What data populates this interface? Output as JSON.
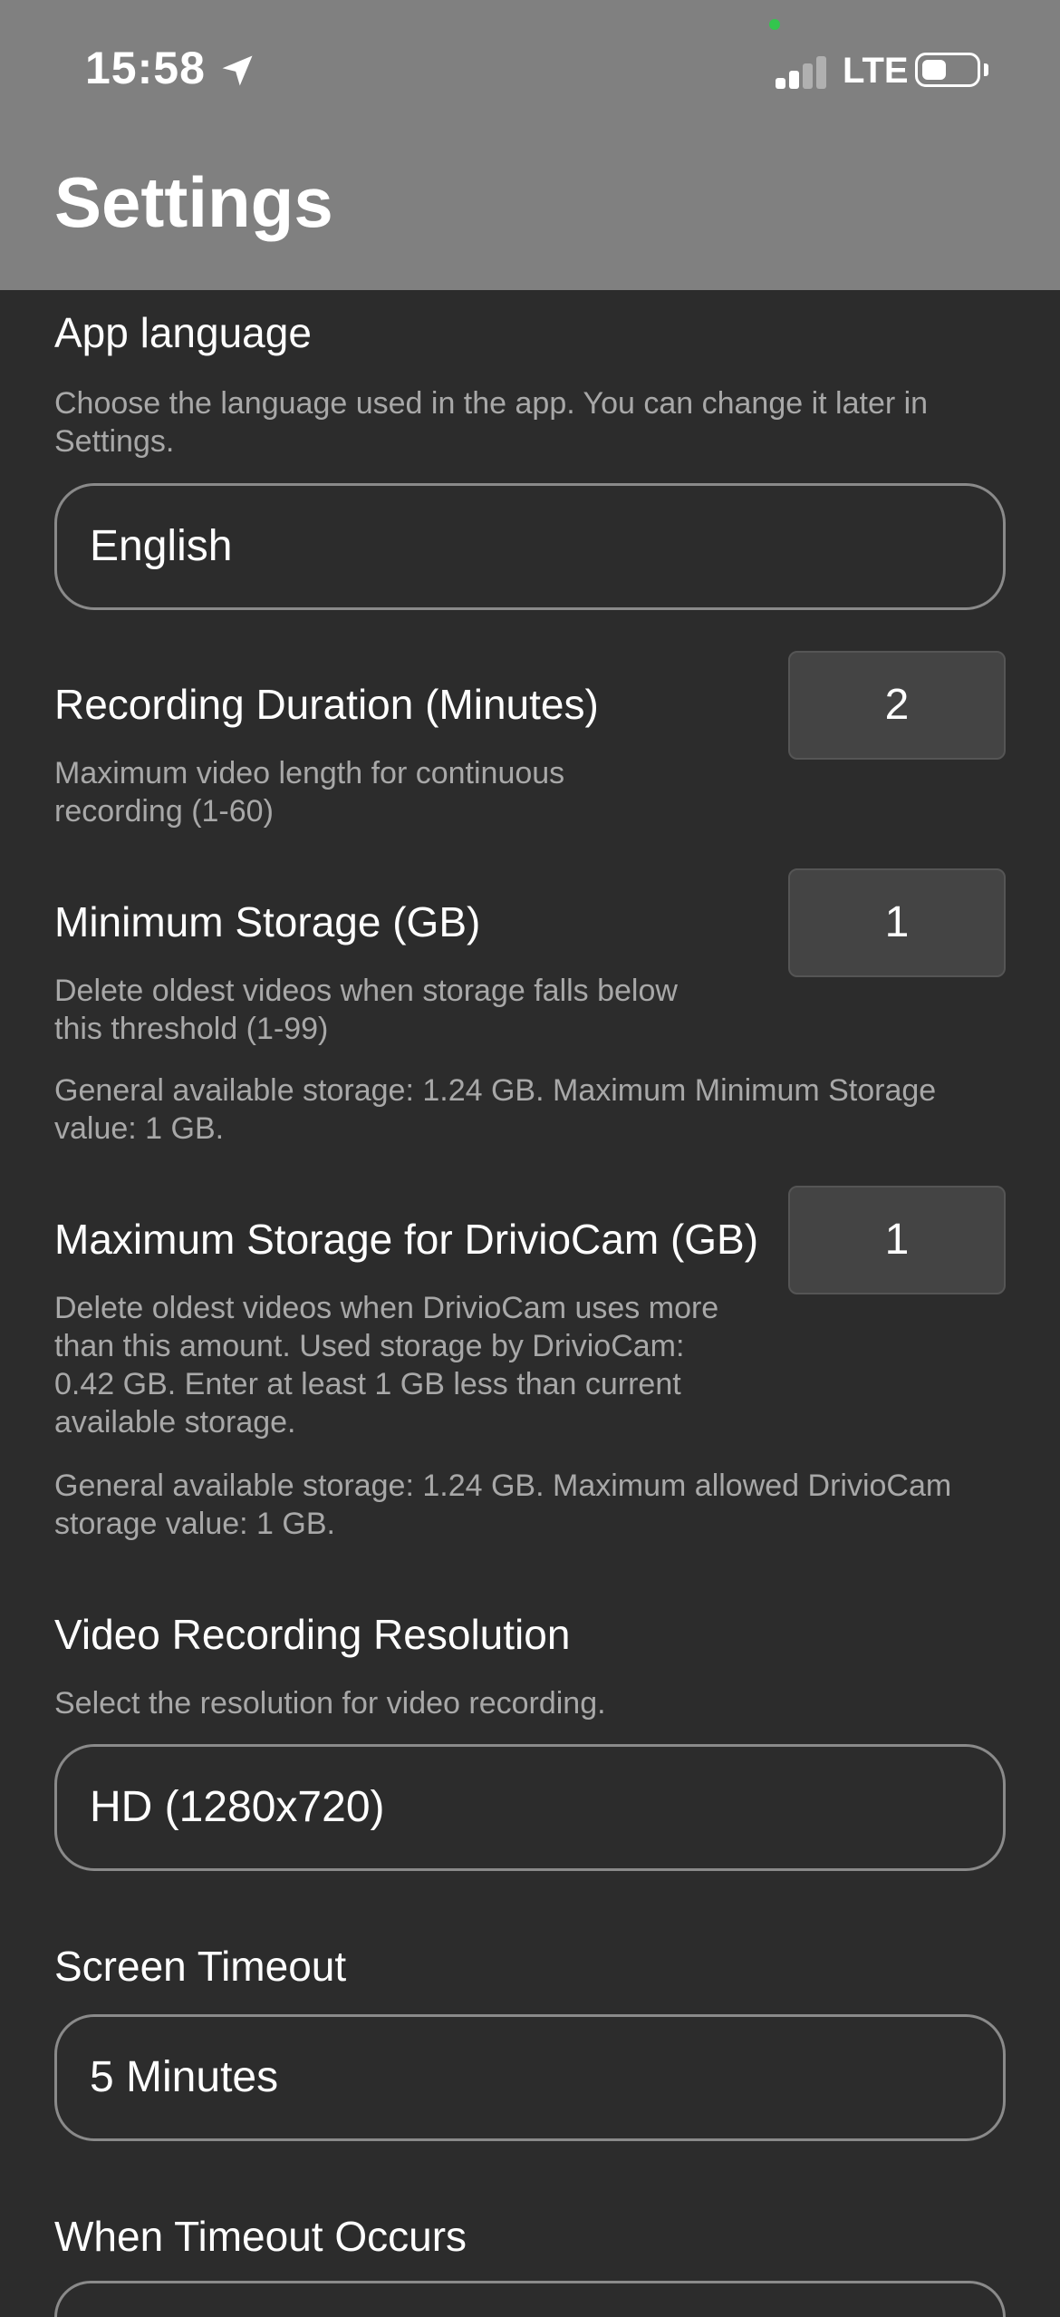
{
  "status_bar": {
    "time": "15:58",
    "network": "LTE"
  },
  "header": {
    "title": "Settings"
  },
  "settings": {
    "app_language": {
      "label": "App language",
      "description": "Choose the language used in the app. You can change it later in Settings.",
      "value": "English"
    },
    "recording_duration": {
      "label": "Recording Duration (Minutes)",
      "description": "Maximum video length for continuous recording (1-60)",
      "value": "2"
    },
    "minimum_storage": {
      "label": "Minimum Storage (GB)",
      "description": "Delete oldest videos when storage falls below this threshold (1-99)",
      "info": "General available storage: 1.24 GB. Maximum Minimum Storage value: 1 GB.",
      "value": "1"
    },
    "maximum_storage": {
      "label": "Maximum Storage for DrivioCam (GB)",
      "description": "Delete oldest videos when DrivioCam uses more than this amount. Used storage by DrivioCam: 0.42 GB. Enter at least 1 GB less than current available storage.",
      "info": "General available storage: 1.24 GB. Maximum allowed DrivioCam storage value: 1 GB.",
      "value": "1"
    },
    "video_resolution": {
      "label": "Video Recording Resolution",
      "description": "Select the resolution for video recording.",
      "value": "HD (1280x720)"
    },
    "screen_timeout": {
      "label": "Screen Timeout",
      "value": "5 Minutes"
    },
    "timeout_action": {
      "label": "When Timeout Occurs"
    }
  },
  "colors": {
    "background": "#2c2c2c",
    "header": "#808080",
    "secondary_text": "#a8a8a8",
    "input_bg": "#444444",
    "mic_indicator": "#33c64d"
  },
  "icons": {
    "location": "location-arrow-icon",
    "signal": "cellular-signal-icon",
    "battery": "battery-icon"
  }
}
